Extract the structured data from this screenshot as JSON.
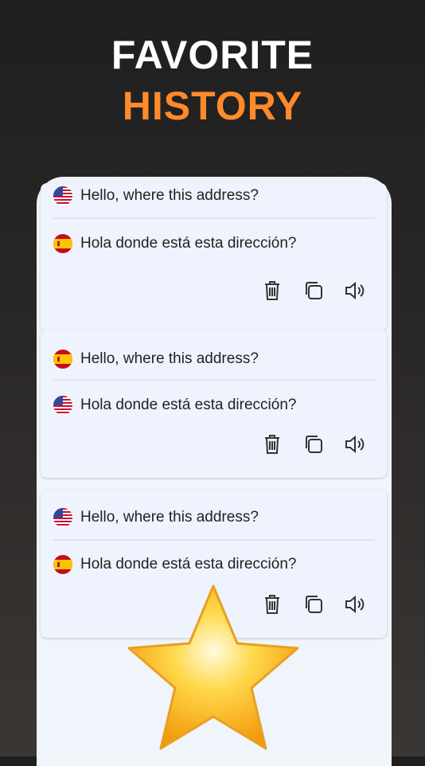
{
  "headline": {
    "line1": "FAVORITE",
    "line2": "HISTORY"
  },
  "colors": {
    "accent": "#ff8a2b",
    "card": "#eef3fd",
    "panel": "#f0f4fb"
  },
  "cards": [
    {
      "source_flag": "us-flag-icon",
      "source_text": "Hello, where this address?",
      "target_flag": "es-flag-icon",
      "target_text": "Hola donde está esta dirección?"
    },
    {
      "source_flag": "es-flag-icon",
      "source_text": "Hello, where this address?",
      "target_flag": "us-flag-icon",
      "target_text": "Hola donde está esta dirección?"
    },
    {
      "source_flag": "us-flag-icon",
      "source_text": "Hello, where this address?",
      "target_flag": "es-flag-icon",
      "target_text": "Hola donde está esta dirección?"
    }
  ],
  "actions": [
    "trash-icon",
    "copy-icon",
    "speaker-icon"
  ],
  "decoration": "star-icon"
}
